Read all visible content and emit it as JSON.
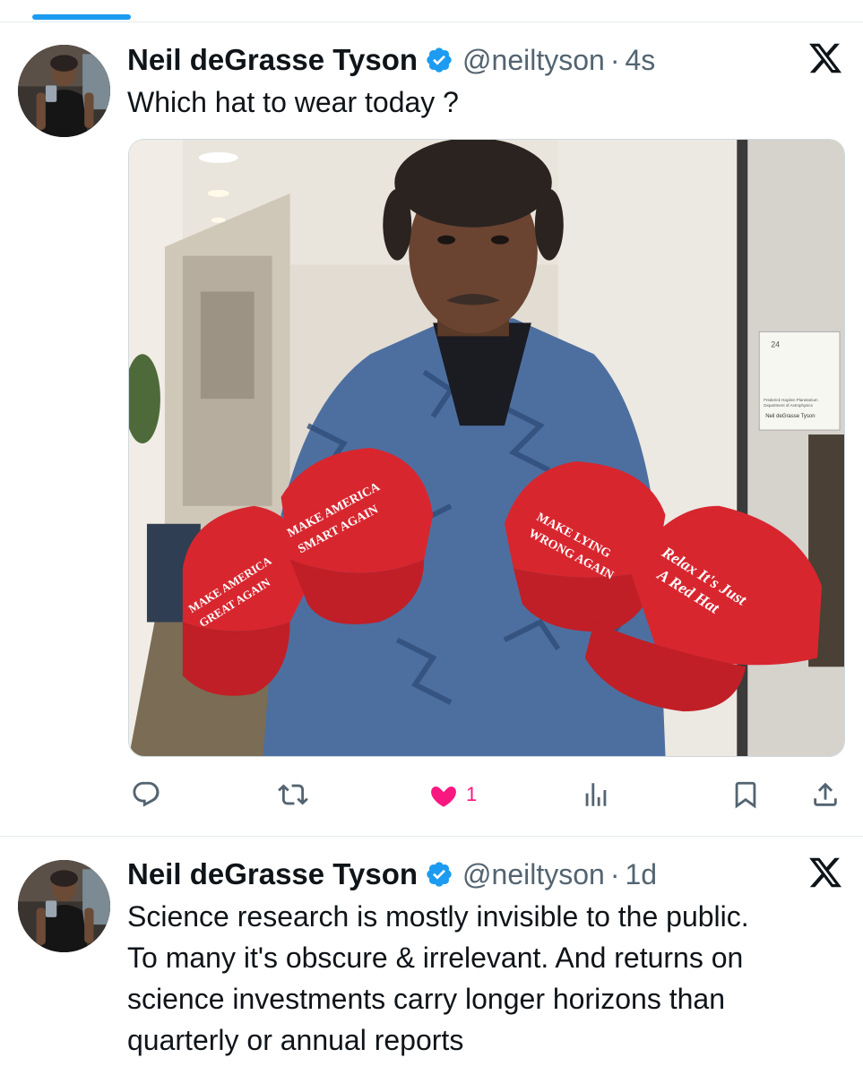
{
  "tweets": [
    {
      "author_name": "Neil deGrasse Tyson",
      "handle": "@neiltyson",
      "separator": "·",
      "time": "4s",
      "text": "Which hat to wear today ?",
      "media": {
        "hat_texts": {
          "hat1_line1": "MAKE AMERICA",
          "hat1_line2": "GREAT AGAIN",
          "hat2_line1": "MAKE AMERICA",
          "hat2_line2": "SMART AGAIN",
          "hat3_line1": "MAKE LYING",
          "hat3_line2": "WRONG AGAIN",
          "hat4_line1": "Relax It's Just",
          "hat4_line2": "A Red Hat"
        },
        "door_sign": {
          "number": "24",
          "line1": "Frederick Hayden Planetarium",
          "line2": "Department of Astrophysics",
          "name": "Neil deGrasse Tyson"
        }
      },
      "actions": {
        "reply_icon": "reply-icon",
        "retweet_icon": "retweet-icon",
        "like_icon": "heart-icon",
        "like_count": "1",
        "views_icon": "views-icon",
        "bookmark_icon": "bookmark-icon",
        "share_icon": "share-icon"
      }
    },
    {
      "author_name": "Neil deGrasse Tyson",
      "handle": "@neiltyson",
      "separator": "·",
      "time": "1d",
      "text_lines": [
        "Science research is mostly invisible to the public.",
        "To many it's obscure & irrelevant. And returns on",
        "science investments carry longer horizons than",
        "quarterly or annual reports"
      ]
    }
  ],
  "colors": {
    "accent_blue": "#1d9bf0",
    "like_pink": "#f91880",
    "secondary_text": "#536471",
    "hat_red": "#d8262f"
  }
}
